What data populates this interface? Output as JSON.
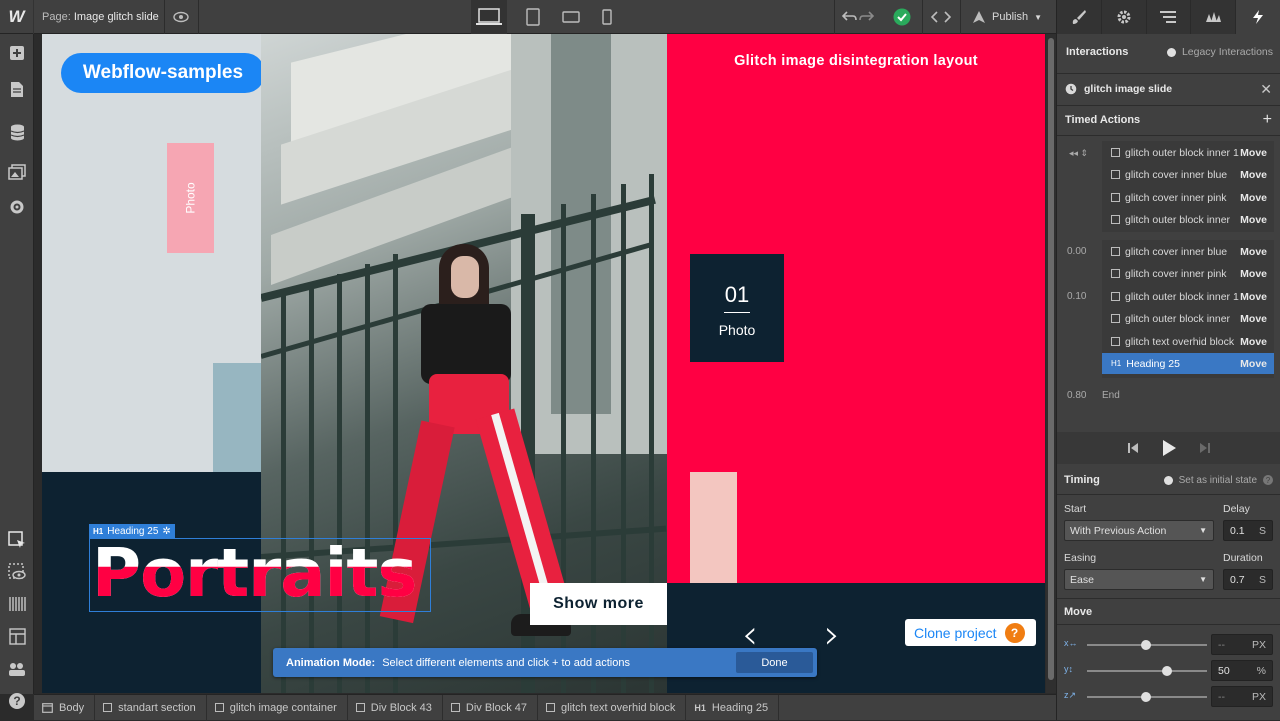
{
  "topbar": {
    "logo": "W",
    "page_label": "Page:",
    "page_name": "Image glitch slide",
    "publish_label": "Publish"
  },
  "canvas": {
    "pill": "Webflow-samples",
    "photo_tag": "Photo",
    "red_title": "Glitch image disintegration layout",
    "number": "01",
    "number_caption": "Photo",
    "heading": "Portraits",
    "heading_tag_prefix": "H1",
    "heading_tag": "Heading 25",
    "show_more": "Show more",
    "clone_project": "Clone project",
    "clone_help": "?",
    "arrow_left": "‹",
    "arrow_right": "›"
  },
  "animation_bar": {
    "mode_label": "Animation Mode:",
    "message": "Select different elements and click + to add actions",
    "done": "Done"
  },
  "breadcrumbs": [
    "Body",
    "standart section",
    "glitch image container",
    "Div Block 43",
    "Div Block 47",
    "glitch text overhid block",
    "Heading 25"
  ],
  "breadcrumb_last_prefix": "H1",
  "panel": {
    "interactions": "Interactions",
    "legacy": "Legacy Interactions",
    "interaction_name": "glitch image slide",
    "timed_actions": "Timed Actions",
    "group1": [
      {
        "name": "glitch outer block inner 1",
        "type": "Move"
      },
      {
        "name": "glitch cover inner blue",
        "type": "Move"
      },
      {
        "name": "glitch cover inner pink",
        "type": "Move"
      },
      {
        "name": "glitch outer block inner",
        "type": "Move"
      }
    ],
    "group2": [
      {
        "name": "glitch cover inner blue",
        "type": "Move"
      },
      {
        "name": "glitch cover inner pink",
        "type": "Move"
      },
      {
        "name": "glitch outer block inner 1",
        "type": "Move"
      },
      {
        "name": "glitch outer block inner",
        "type": "Move"
      },
      {
        "name": "glitch text overhid block",
        "type": "Move"
      },
      {
        "name": "Heading 25",
        "type": "Move",
        "prefix": "H1"
      }
    ],
    "times": [
      "0.00",
      "0.10",
      "0.80"
    ],
    "end_label": "End",
    "timing": "Timing",
    "initial_state": "Set as initial state",
    "start_label": "Start",
    "start_value": "With Previous Action",
    "delay_label": "Delay",
    "delay_value": "0.1",
    "delay_unit": "S",
    "easing_label": "Easing",
    "easing_value": "Ease",
    "duration_label": "Duration",
    "duration_value": "0.7",
    "duration_unit": "S",
    "move_label": "Move",
    "move_x": "--",
    "move_x_unit": "PX",
    "move_y": "50",
    "move_y_unit": "%",
    "move_z": "--",
    "move_z_unit": "PX",
    "move_y_fraction": 0.5
  }
}
